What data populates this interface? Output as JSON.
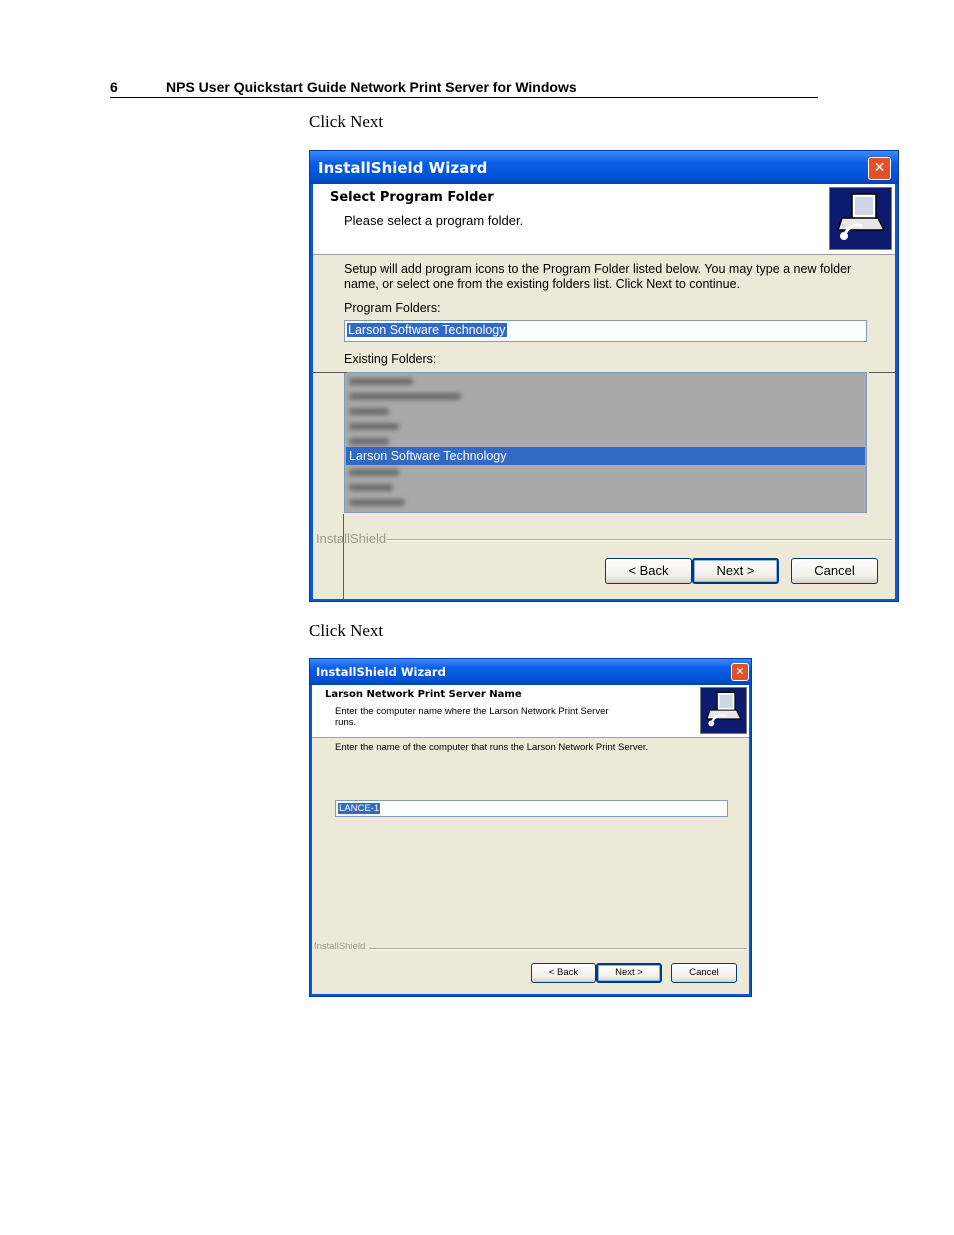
{
  "header": {
    "page_number": "6",
    "title": "NPS User Quickstart Guide Network Print Server for Windows"
  },
  "instructions": [
    "Click Next",
    "Click Next"
  ],
  "dialog1": {
    "window_title": "InstallShield Wizard",
    "heading": "Select Program Folder",
    "subheading": "Please select a program folder.",
    "description": "Setup will add program icons to the Program Folder listed below.  You may type a new folder name, or select one from the existing folders list.  Click Next to continue.",
    "program_folders_label": "Program Folders:",
    "program_folder_value": "Larson Software Technology",
    "existing_folders_label": "Existing Folders:",
    "existing_folders_selected": "Larson Software Technology",
    "brand": "InstallShield",
    "buttons": {
      "back": "< Back",
      "next": "Next >",
      "cancel": "Cancel"
    },
    "close_glyph": "✕"
  },
  "dialog2": {
    "window_title": "InstallShield Wizard",
    "heading": "Larson Network Print Server Name",
    "subheading": "Enter the computer name where the Larson Network Print Server runs.",
    "description": "Enter the name of the computer that runs the Larson Network Print Server.",
    "computer_name_value": "LANCE-1",
    "brand": "InstallShield",
    "buttons": {
      "back": "< Back",
      "next": "Next >",
      "cancel": "Cancel"
    },
    "close_glyph": "✕"
  },
  "colors": {
    "titlebar": "#0a5fe6",
    "selection": "#316ac5",
    "close": "#e2512b",
    "dialog_face": "#ece9d8"
  }
}
